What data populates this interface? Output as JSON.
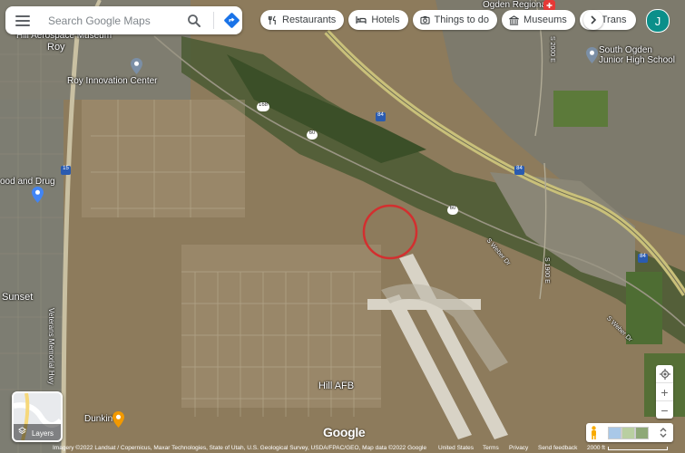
{
  "search": {
    "placeholder": "Search Google Maps"
  },
  "chips": [
    "Restaurants",
    "Hotels",
    "Things to do",
    "Museums",
    "Trans"
  ],
  "account": {
    "initial": "J",
    "color": "#0b8f8a"
  },
  "places": {
    "hill_aerospace": "Hill Aerospace Museum",
    "roy": "Roy",
    "roy_innovation": "Roy Innovation Center",
    "food_drug": "ood and Drug",
    "sunset": "Sunset",
    "ogden_regional": "Ogden Regional",
    "south_ogden_1": "South Ogden",
    "south_ogden_2": "Junior High School",
    "hill_afb": "Hill AFB",
    "dunkin": "Dunkin'",
    "veterans_hwy": "Veterans Memorial Hwy",
    "s_weber_dr_1": "S Weber Dr",
    "s_weber_dr_2": "S Weber Dr",
    "east_st_1": "S 2000 E",
    "east_st_2": "S 1900 E"
  },
  "shields": {
    "i15": "15",
    "i84a": "84",
    "i84b": "84",
    "i84c": "84",
    "i84d": "84",
    "r60a": "60",
    "r60b": "60",
    "r168": "168"
  },
  "layers_label": "Layers",
  "controls": {
    "zoom_in": "+",
    "zoom_out": "−"
  },
  "google_logo": "Google",
  "footer": {
    "imagery": "Imagery ©2022 Landsat / Copernicus, Maxar Technologies, State of Utah, U.S. Geological Survey, USDA/FPAC/GEO, Map data ©2022 Google",
    "country": "United States",
    "terms": "Terms",
    "privacy": "Privacy",
    "feedback": "Send feedback",
    "scale": "2000 ft"
  },
  "colors": {
    "marker_circle": "#d32f2f",
    "accent_blue": "#1a73e8"
  }
}
